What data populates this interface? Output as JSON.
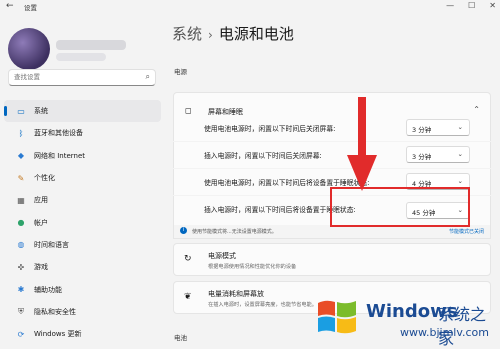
{
  "window": {
    "title": "设置",
    "back_glyph": "←",
    "minimize": "—",
    "maximize": "☐",
    "close": "✕"
  },
  "sidebar": {
    "search_placeholder": "查找设置",
    "items": [
      {
        "label": "系统",
        "icon": "monitor-icon",
        "glyph": "▭",
        "color": "#0067c0",
        "active": true
      },
      {
        "label": "蓝牙和其他设备",
        "icon": "bluetooth-icon",
        "glyph": "ᛒ",
        "color": "#0067c0"
      },
      {
        "label": "网络和 Internet",
        "icon": "wifi-icon",
        "glyph": "◆",
        "color": "#2a7ad1"
      },
      {
        "label": "个性化",
        "icon": "brush-icon",
        "glyph": "✎",
        "color": "#c47a22"
      },
      {
        "label": "应用",
        "icon": "apps-icon",
        "glyph": "▦",
        "color": "#555555"
      },
      {
        "label": "帐户",
        "icon": "account-icon",
        "glyph": "●",
        "color": "#2ea36b"
      },
      {
        "label": "时间和语言",
        "icon": "globe-clock-icon",
        "glyph": "◍",
        "color": "#2a7ad1"
      },
      {
        "label": "游戏",
        "icon": "gamepad-icon",
        "glyph": "✜",
        "color": "#666666"
      },
      {
        "label": "辅助功能",
        "icon": "accessibility-icon",
        "glyph": "✱",
        "color": "#2a7ad1"
      },
      {
        "label": "隐私和安全性",
        "icon": "shield-icon",
        "glyph": "⛨",
        "color": "#555555"
      },
      {
        "label": "Windows 更新",
        "icon": "update-icon",
        "glyph": "⟳",
        "color": "#2a7ad1"
      }
    ]
  },
  "main": {
    "breadcrumb_parent": "系统",
    "breadcrumb_sep": "›",
    "page_title": "电源和电池",
    "section_power": "电源",
    "screen_sleep": {
      "label": "屏幕和睡眠",
      "chevron": "⌃"
    },
    "rows": [
      {
        "label": "使用电池电源时，闲置以下时间后关闭屏幕:",
        "value": "3 分钟"
      },
      {
        "label": "插入电源时，闲置以下时间后关闭屏幕:",
        "value": "3 分钟"
      },
      {
        "label": "使用电池电源时，闲置以下时间后将设备置于睡眠状态:",
        "value": "4 分钟"
      },
      {
        "label": "插入电源时，闲置以下时间后将设备置于睡眠状态:",
        "value": "45 分钟"
      }
    ],
    "dropdown_chevron": "⌄",
    "info_text": "使用节能模式将...无法设置电源模式。",
    "info_link": "节能模式已关闭",
    "power_mode": {
      "title": "电源模式",
      "desc": "根据电源使用情况和性能优化你的设备"
    },
    "saver": {
      "title": "电量消耗和屏幕放",
      "desc": "在插入电源时，设置屏幕亮度，也能节省电能。"
    },
    "section_battery": "电池"
  },
  "watermark": {
    "brand": "Windows",
    "cn": "系统之家",
    "url": "www.bjjmlv.com"
  },
  "colors": {
    "accent": "#0067c0",
    "highlight": "#e12b2b",
    "brand": "#1b4b93"
  }
}
